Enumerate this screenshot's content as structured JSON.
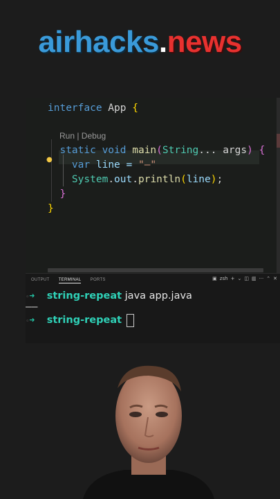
{
  "logo": {
    "part1": "airhacks",
    "dot": ".",
    "part2": "news"
  },
  "editor": {
    "code_lens": "Run | Debug",
    "lines": {
      "l1": {
        "kw": "interface",
        "name": " App ",
        "brace": "{"
      },
      "l3": {
        "indent": "  ",
        "kw": "static void",
        "sp": " ",
        "fn": "main",
        "paren_open": "(",
        "type": "String",
        "rest": "... args",
        "paren_close": ")",
        "sp2": " ",
        "brace": "{"
      },
      "l4": {
        "indent": "    ",
        "kw": "var",
        "rest": " line = ",
        "str": "\"–\""
      },
      "l5": {
        "indent": "    ",
        "obj": "System",
        "d1": ".",
        "field": "out",
        "d2": ".",
        "fn": "println",
        "p1": "(",
        "arg": "line",
        "p2": ")",
        "semi": ";"
      },
      "l6": {
        "indent": "  ",
        "brace": "}"
      },
      "l7": {
        "brace": "}"
      }
    }
  },
  "panel": {
    "tabs": [
      "OUTPUT",
      "TERMINAL",
      "PORTS"
    ],
    "active_tab": "TERMINAL",
    "shell_label": "zsh",
    "icons": [
      "terminal-icon",
      "plus-icon",
      "chevron-down-icon",
      "split-icon",
      "trash-icon",
      "more-icon",
      "chevron-up-icon",
      "close-icon"
    ]
  },
  "terminal": {
    "lines": [
      {
        "marker": "◦",
        "arrow": "➜",
        "dir": "string-repeat",
        "cmd": " java app.java"
      },
      {
        "output": "––"
      },
      {
        "marker": "◦",
        "arrow": "➜",
        "dir": "string-repeat",
        "cmd": " "
      }
    ]
  },
  "colors": {
    "accent_blue": "#3a9ad9",
    "accent_red": "#e8312f",
    "terminal_prompt": "#2fd1b7"
  }
}
